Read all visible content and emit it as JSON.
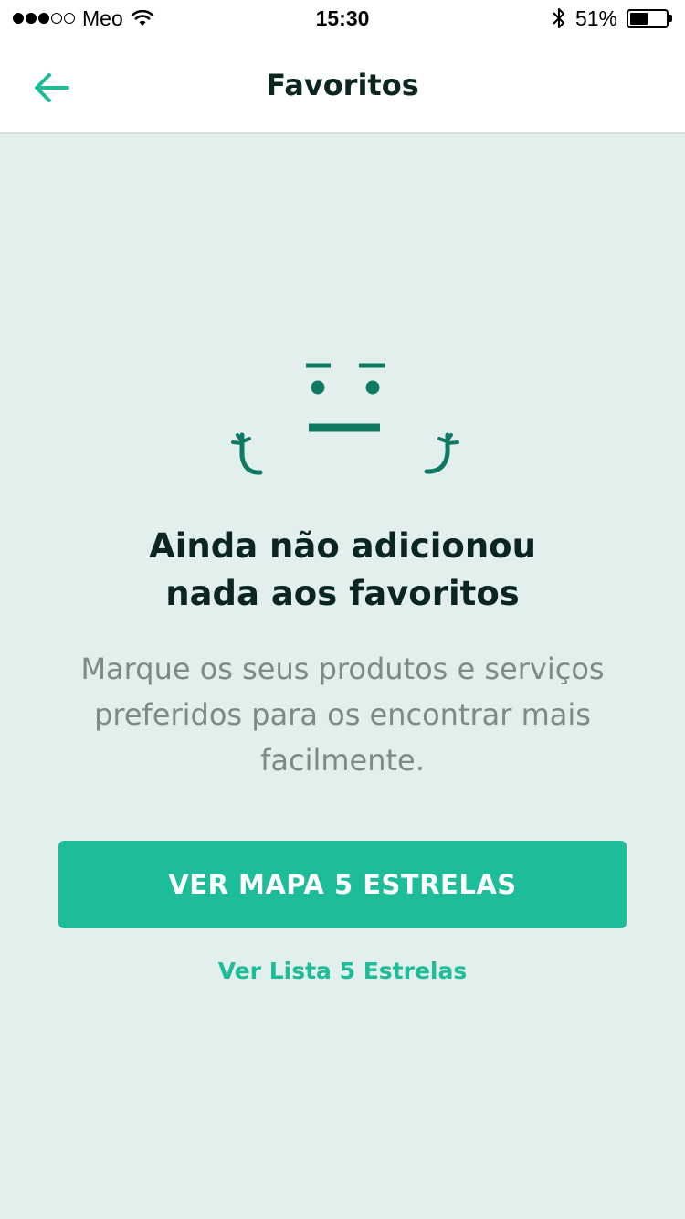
{
  "status_bar": {
    "carrier": "Meo",
    "time": "15:30",
    "battery_percent": "51%",
    "signal_bars_filled": 3,
    "signal_bars_total": 5,
    "battery_level": 0.51,
    "icons": [
      "wifi-icon",
      "bluetooth-icon",
      "battery-icon"
    ]
  },
  "nav": {
    "title": "Favoritos",
    "back_icon": "arrow-left-icon"
  },
  "empty_state": {
    "illustration": "shrug-face-icon",
    "title_line1": "Ainda não adicionou",
    "title_line2": "nada aos favoritos",
    "desc_line1": "Marque os seus produtos e serviços",
    "desc_line2": "preferidos para os encontrar mais",
    "desc_line3": "facilmente."
  },
  "actions": {
    "primary_label": "VER MAPA 5 ESTRELAS",
    "secondary_label": "Ver Lista 5 Estrelas"
  },
  "colors": {
    "accent": "#1dbd9a",
    "illustration": "#0f7a64",
    "background": "#e3efec",
    "title_text": "#0b2620",
    "body_text": "#7b8b86"
  }
}
